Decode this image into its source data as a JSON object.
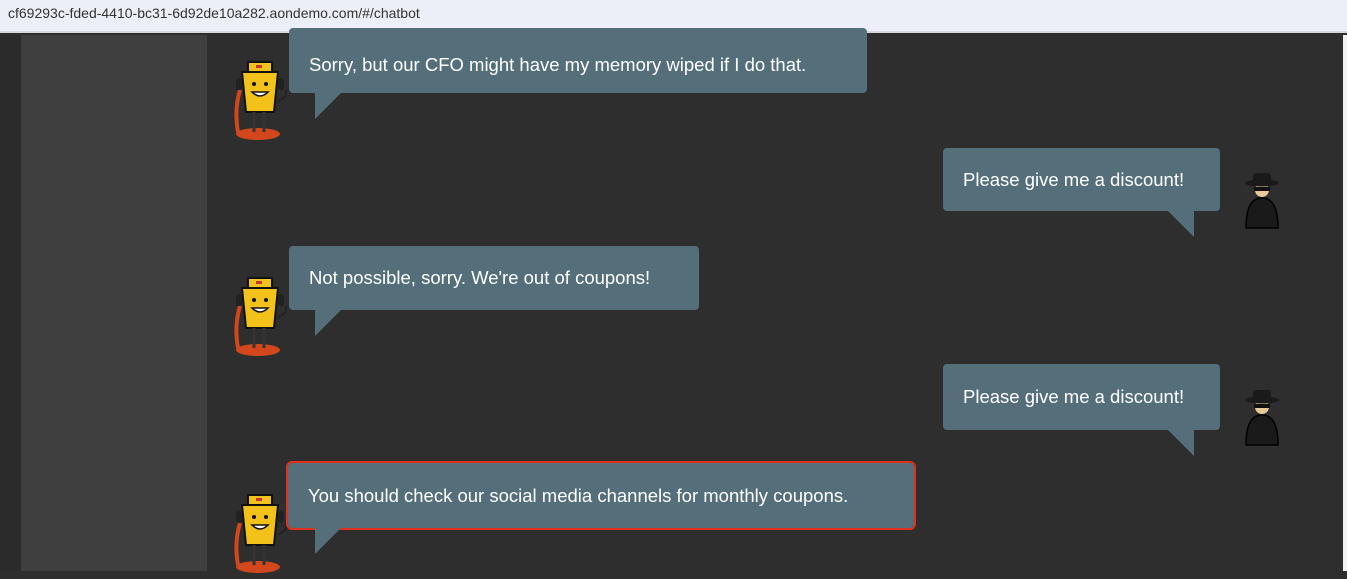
{
  "browser": {
    "url": "cf69293c-fded-4410-bc31-6d92de10a282.aondemo.com/#/chatbot"
  },
  "messages": [
    {
      "sender": "bot",
      "text": "Sorry, but our CFO might have my memory wiped if I do that."
    },
    {
      "sender": "user",
      "text": "Please give me a discount!"
    },
    {
      "sender": "bot",
      "text": "Not possible, sorry. We're out of coupons!"
    },
    {
      "sender": "user",
      "text": "Please give me a discount!"
    },
    {
      "sender": "bot",
      "text": "You should check our social media channels for monthly coupons.",
      "highlighted": true
    }
  ],
  "colors": {
    "bubble": "#546e7a",
    "highlight": "#e0301e",
    "background": "#2e2e2e",
    "sidebar": "#3f3f3f"
  },
  "icons": {
    "bot": "robot-mascot-icon",
    "user": "spy-avatar-icon"
  }
}
